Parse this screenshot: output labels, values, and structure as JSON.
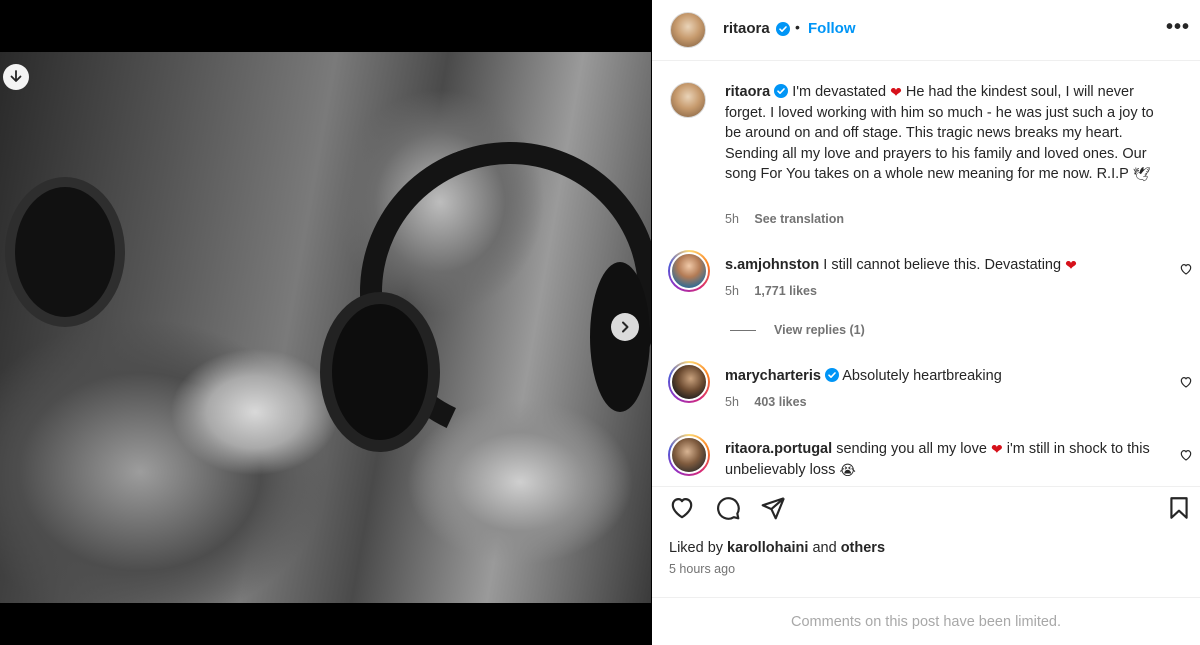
{
  "post": {
    "author": "ritaora",
    "follow_label": "Follow",
    "separator": "•",
    "more_label": "•••",
    "media": {
      "slide_index": 2,
      "slide_count": 7
    }
  },
  "caption": {
    "username": "ritaora",
    "text_1": "I'm devastated",
    "text_2": "He had the kindest soul, I will never forget. I loved working with him so much - he was just such a joy to be around on and off stage. This tragic news breaks my heart. Sending all my love and prayers to his family and loved ones. Our song For You takes on a whole new meaning for me now. R.I.P",
    "time": "5h",
    "see_translation": "See translation"
  },
  "comments": [
    {
      "username": "s.amjohnston",
      "text": "I still cannot believe this. Devastating",
      "time": "5h",
      "likes": "1,771 likes",
      "view_replies": "View replies (1)"
    },
    {
      "username": "marycharteris",
      "text": "Absolutely heartbreaking",
      "time": "5h",
      "likes": "403 likes"
    },
    {
      "username": "ritaora.portugal",
      "text_1": "sending you all my love",
      "text_2": "i'm still in shock to this unbelievably loss"
    }
  ],
  "footer": {
    "liked_by_prefix": "Liked by",
    "liked_by_user": "karollohaini",
    "liked_by_and": "and",
    "liked_by_others": "others",
    "time": "5 hours ago",
    "limited_notice": "Comments on this post have been limited."
  },
  "icons": {
    "heart": "heart-icon",
    "comment": "comment-icon",
    "share": "share-icon",
    "save": "bookmark-icon",
    "verified": "verified-icon",
    "download": "arrow-down-icon",
    "next": "chevron-right-icon"
  },
  "colors": {
    "accent": "#0095f6",
    "verified": "#0095f6",
    "heart": "#d6111a",
    "muted": "#737373"
  }
}
